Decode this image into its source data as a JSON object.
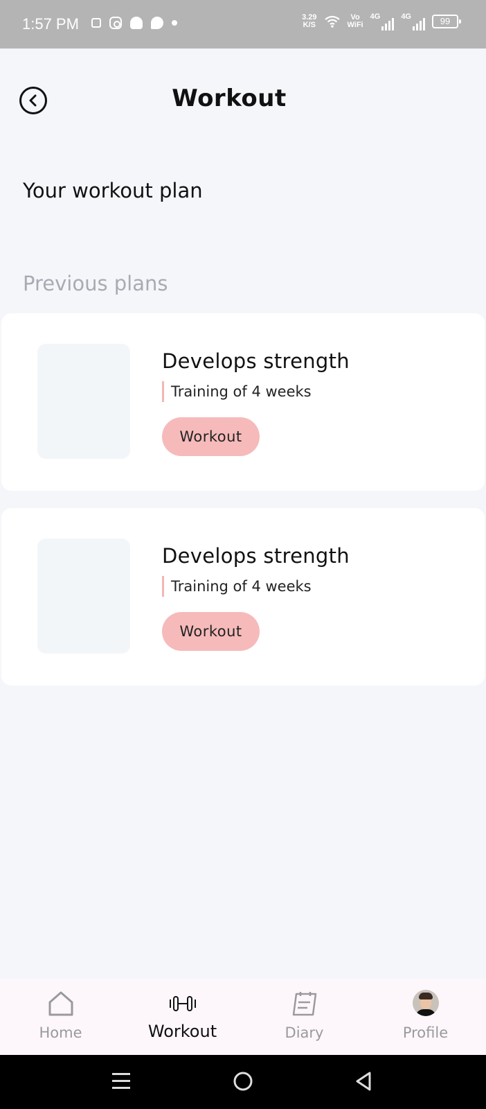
{
  "status_bar": {
    "time": "1:57 PM",
    "speed_value": "3.29",
    "speed_unit": "K/S",
    "vowifi_top": "Vo",
    "vowifi_bottom": "WiFi",
    "network_1": "4G",
    "network_2": "4G",
    "battery": "99"
  },
  "header": {
    "title": "Workout"
  },
  "main": {
    "plan_heading": "Your workout plan",
    "previous_heading": "Previous plans",
    "plans": [
      {
        "title": "Develops strength",
        "subtitle": "Training of 4 weeks",
        "button": "Workout"
      },
      {
        "title": "Develops strength",
        "subtitle": "Training of 4 weeks",
        "button": "Workout"
      }
    ]
  },
  "bottom_nav": {
    "items": [
      {
        "label": "Home",
        "icon": "home-icon"
      },
      {
        "label": "Workout",
        "icon": "dumbbell-icon"
      },
      {
        "label": "Diary",
        "icon": "diary-icon"
      },
      {
        "label": "Profile",
        "icon": "avatar"
      }
    ],
    "active": "Workout"
  },
  "colors": {
    "accent": "#f6baba",
    "background": "#f5f6fa",
    "card": "#ffffff"
  }
}
